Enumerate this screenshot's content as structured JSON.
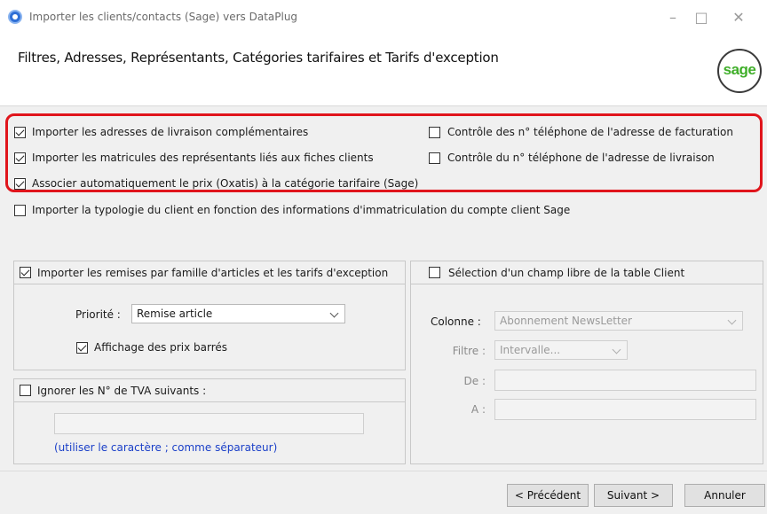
{
  "window": {
    "title": "Importer les clients/contacts (Sage) vers DataPlug",
    "controls": [
      "minimize",
      "maximize",
      "close"
    ]
  },
  "header": {
    "title": "Filtres, Adresses, Représentants, Catégories tarifaires et Tarifs d'exception",
    "logo_text": "sage"
  },
  "options": {
    "import_delivery_addresses": {
      "label": "Importer les adresses de livraison complémentaires",
      "checked": true
    },
    "import_rep_ids": {
      "label": "Importer les matricules des représentants liés aux fiches clients",
      "checked": true
    },
    "assoc_price": {
      "label": "Associer automatiquement le prix (Oxatis) à la catégorie tarifaire (Sage)",
      "checked": true
    },
    "check_billing_phone": {
      "label": "Contrôle des n° téléphone de l'adresse de facturation",
      "checked": false
    },
    "check_delivery_phone": {
      "label": "Contrôle du n° téléphone de l'adresse de livraison",
      "checked": false
    },
    "import_typology": {
      "label": "Importer la typologie du client en fonction des informations d'immatriculation du compte client Sage",
      "checked": false
    }
  },
  "discounts": {
    "label": "Importer les remises par famille d'articles et les tarifs d'exception",
    "checked": true,
    "priority_label": "Priorité :",
    "priority_value": "Remise article",
    "strike_label": "Affichage des prix barrés",
    "strike_checked": true
  },
  "vat": {
    "label": "Ignorer les N° de TVA suivants :",
    "checked": false,
    "value": "",
    "hint": "(utiliser le caractère ; comme séparateur)"
  },
  "free_field": {
    "label": "Sélection d'un champ libre de la table Client",
    "checked": false,
    "column_label": "Colonne :",
    "column_value": "Abonnement NewsLetter",
    "filter_label": "Filtre :",
    "filter_value": "Intervalle...",
    "from_label": "De :",
    "from_value": "",
    "to_label": "A :",
    "to_value": ""
  },
  "footer": {
    "prev": "< Précédent",
    "next": "Suivant >",
    "cancel": "Annuler"
  },
  "colors": {
    "highlight": "#e0151c",
    "logo_green": "#3fae29",
    "hint_blue": "#1a3fc8"
  }
}
